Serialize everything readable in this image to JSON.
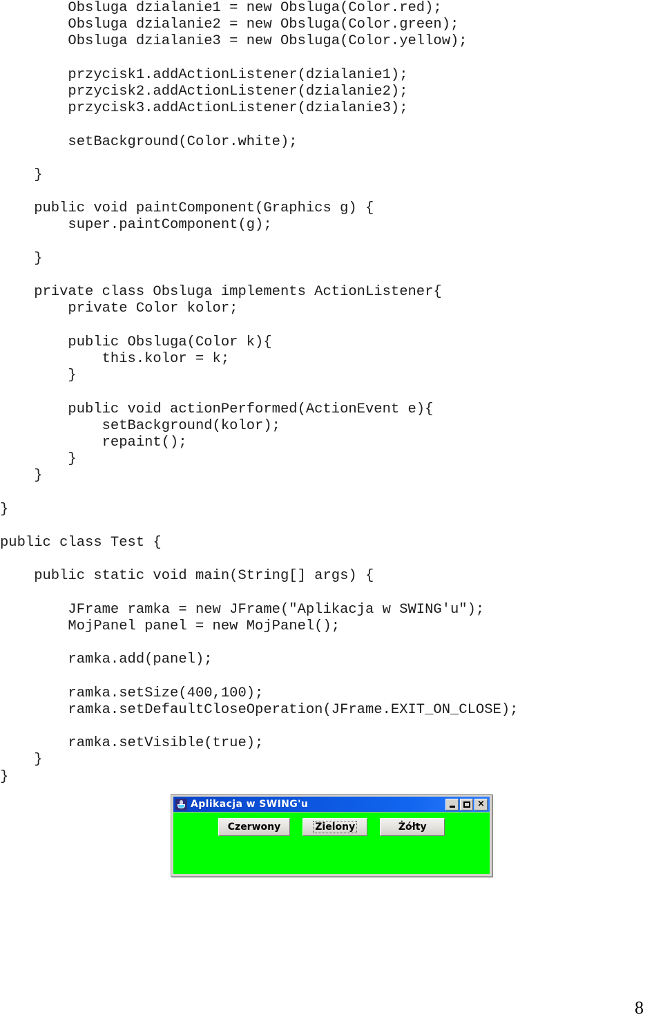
{
  "document": {
    "page_number": "8",
    "code_lines": [
      "        Obsluga dzialanie1 = new Obsluga(Color.red);",
      "        Obsluga dzialanie2 = new Obsluga(Color.green);",
      "        Obsluga dzialanie3 = new Obsluga(Color.yellow);",
      "",
      "        przycisk1.addActionListener(dzialanie1);",
      "        przycisk2.addActionListener(dzialanie2);",
      "        przycisk3.addActionListener(dzialanie3);",
      "",
      "        setBackground(Color.white);",
      "",
      "    }",
      "",
      "    public void paintComponent(Graphics g) {",
      "        super.paintComponent(g);",
      "",
      "    }",
      "",
      "    private class Obsluga implements ActionListener{",
      "        private Color kolor;",
      "",
      "        public Obsluga(Color k){",
      "            this.kolor = k;",
      "        }",
      "",
      "        public void actionPerformed(ActionEvent e){",
      "            setBackground(kolor);",
      "            repaint();",
      "        }",
      "    }",
      "",
      "}",
      "",
      "public class Test {",
      "",
      "    public static void main(String[] args) {",
      "",
      "        JFrame ramka = new JFrame(\"Aplikacja w SWING'u\");",
      "        MojPanel panel = new MojPanel();",
      "",
      "        ramka.add(panel);",
      "",
      "        ramka.setSize(400,100);",
      "        ramka.setDefaultCloseOperation(JFrame.EXIT_ON_CLOSE);",
      "",
      "        ramka.setVisible(true);",
      "    }",
      "}"
    ]
  },
  "swing_window": {
    "title": "Aplikacja w SWING'u",
    "icon": "java-cup-icon",
    "panel_color": "#00ff00",
    "titlebar_color": "#0d57e0",
    "controls": [
      {
        "name": "minimize-button",
        "label": ""
      },
      {
        "name": "maximize-button",
        "label": ""
      },
      {
        "name": "close-button",
        "label": "×"
      }
    ],
    "buttons": [
      {
        "label": "Czerwony",
        "focused": false
      },
      {
        "label": "Zielony",
        "focused": true
      },
      {
        "label": "Żółty",
        "focused": false
      }
    ]
  }
}
